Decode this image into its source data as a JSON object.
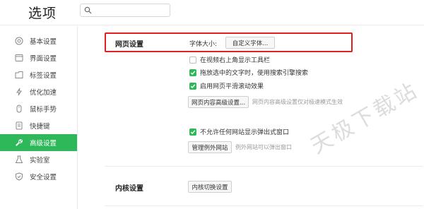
{
  "header": {
    "title": "选项",
    "search_placeholder": "",
    "search_value": ""
  },
  "sidebar": {
    "items": [
      {
        "label": "基本设置",
        "icon": "target-icon",
        "active": false
      },
      {
        "label": "界面设置",
        "icon": "window-icon",
        "active": false
      },
      {
        "label": "标签设置",
        "icon": "tab-icon",
        "active": false
      },
      {
        "label": "优化加速",
        "icon": "lightning-icon",
        "active": false
      },
      {
        "label": "鼠标手势",
        "icon": "mouse-icon",
        "active": false
      },
      {
        "label": "快捷键",
        "icon": "document-icon",
        "active": false
      },
      {
        "label": "高级设置",
        "icon": "wrench-icon",
        "active": true
      },
      {
        "label": "实验室",
        "icon": "flask-icon",
        "active": false
      },
      {
        "label": "安全设置",
        "icon": "shield-icon",
        "active": false
      }
    ]
  },
  "web_settings": {
    "title": "网页设置",
    "font_size_label": "字体大小:",
    "custom_font_button": "自定义字体...",
    "options": [
      {
        "label": "在视频右上角显示工具栏",
        "checked": false
      },
      {
        "label": "拖放选中的文字时，使用搜索引擎搜索",
        "checked": true
      },
      {
        "label": "启用网页平滑滚动效果",
        "checked": true
      }
    ],
    "advanced_button": "网页内容高级设置...",
    "advanced_hint": "网页内容高级设置仅对极速模式生效",
    "popup_option": {
      "label": "不允许任何网站显示弹出式窗口",
      "checked": true
    },
    "exceptions_button": "管理例外网站",
    "exceptions_hint": "例外网站可以弹出窗口"
  },
  "kernel_settings": {
    "title": "内核设置",
    "switch_button": "内核切换设置"
  },
  "watermark": "天极下载站",
  "colors": {
    "accent": "#2fb85a",
    "highlight_border": "#e02020"
  }
}
